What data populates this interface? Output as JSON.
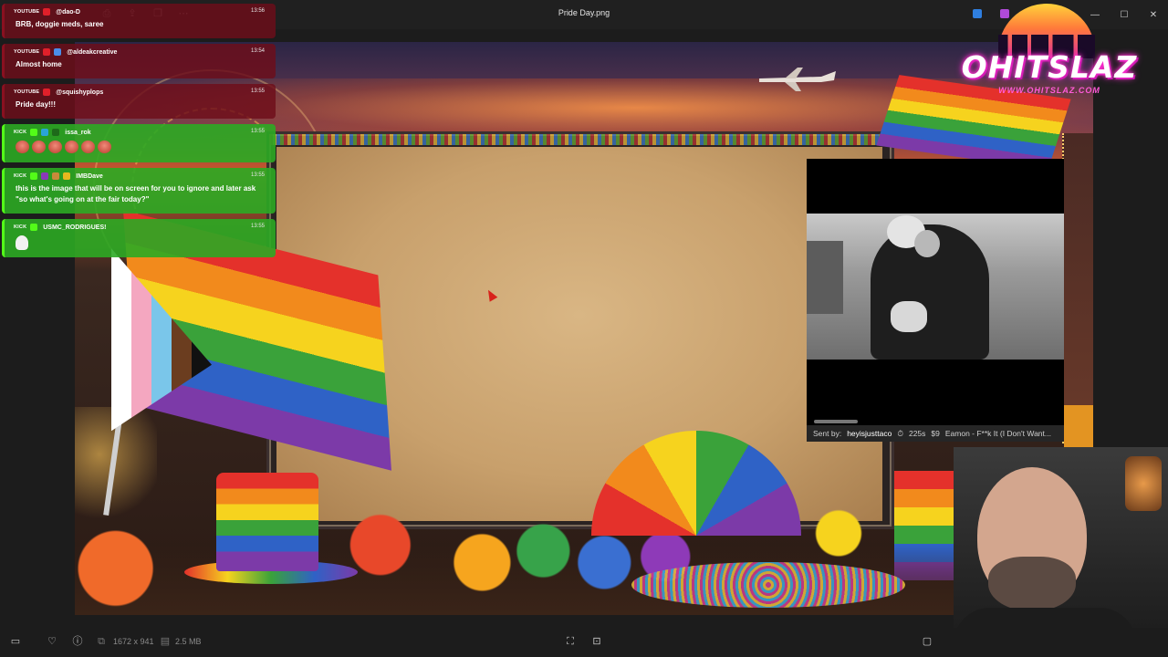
{
  "window": {
    "title": "Pride Day.png",
    "minimize_glyph": "—",
    "maximize_glyph": "☐",
    "close_glyph": "✕"
  },
  "image": {
    "dimensions": "1672 x 941",
    "file_size": "2.5 MB"
  },
  "logo": {
    "name": "OHITSLAZ",
    "url": "WWW.OHITSLAZ.COM"
  },
  "media_alert": {
    "sent_by_label": "Sent by:",
    "sender": "heyisjusttaco",
    "duration": "225s",
    "price": "$9",
    "song": "Eamon - F**k It (I Don't Want..."
  },
  "chat": {
    "messages": [
      {
        "platform": "YOUTUBE",
        "user": "@dao-D",
        "time": "13:56",
        "text": "BRB, doggie meds, saree"
      },
      {
        "platform": "YOUTUBE",
        "user": "@aldeakcreative",
        "time": "13:54",
        "text": "Almost home"
      },
      {
        "platform": "YOUTUBE",
        "user": "@squishyplops",
        "time": "13:55",
        "text": "Pride day!!!"
      },
      {
        "platform": "KICK",
        "user": "issa_rok",
        "time": "13:55",
        "text": ""
      },
      {
        "platform": "KICK",
        "user": "IMBDave",
        "time": "13:55",
        "text": "this is the image that will be on screen for you to ignore and later ask \"so what's going on at the fair today?\""
      },
      {
        "platform": "KICK",
        "user": "USMC_RODRIGUES!",
        "time": "13:55",
        "text": ""
      }
    ]
  },
  "colors": {
    "youtube_bg": "#6e0e1a",
    "kick_bg": "#2caa24",
    "logo_glow": "#ff2fd0"
  }
}
